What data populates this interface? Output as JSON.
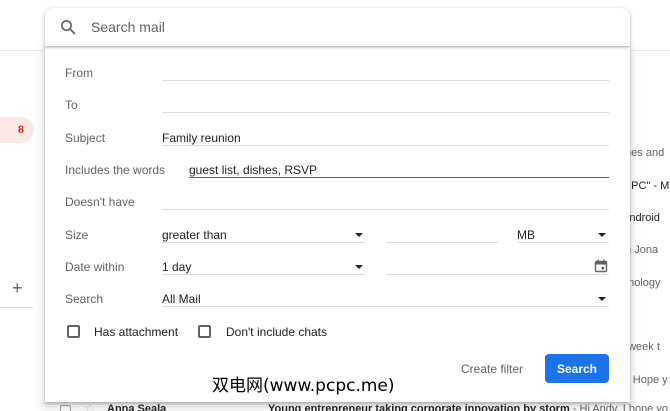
{
  "colors": {
    "accent": "#1a73e8",
    "unread_badge": "#d93025",
    "unread_background": "#fce8e6"
  },
  "search_bar": {
    "placeholder": "Search mail",
    "icon": "search-icon"
  },
  "background": {
    "unread_count": "8",
    "compose_icon": "plus-icon",
    "right_snippets": [
      "mes and",
      "d PC\" - M",
      "Android",
      "m Jona",
      "hnology",
      "t week t",
      "y, Hope y"
    ],
    "email_row": {
      "sender": "Anna Seala",
      "subject": "Young entrepreneur taking corporate innovation by storm",
      "snippet": " - Hi Andy, I hope yo"
    }
  },
  "advanced_search": {
    "from": {
      "label": "From",
      "value": ""
    },
    "to": {
      "label": "To",
      "value": ""
    },
    "subject": {
      "label": "Subject",
      "value": "Family reunion"
    },
    "includes_words": {
      "label": "Includes the words",
      "value": "guest list, dishes, RSVP"
    },
    "doesnt_have": {
      "label": "Doesn't have",
      "value": ""
    },
    "size": {
      "label": "Size",
      "comparator": "greater than",
      "amount": "",
      "unit": "MB"
    },
    "date_within": {
      "label": "Date within",
      "value": "1 day",
      "date": "",
      "icon": "calendar-icon"
    },
    "search_in": {
      "label": "Search",
      "value": "All Mail"
    },
    "has_attachment": {
      "label": "Has attachment",
      "checked": false
    },
    "dont_include_chats": {
      "label": "Don't include chats",
      "checked": false
    },
    "create_filter_label": "Create filter",
    "search_button_label": "Search"
  },
  "watermark": "双电网(www.pcpc.me)"
}
